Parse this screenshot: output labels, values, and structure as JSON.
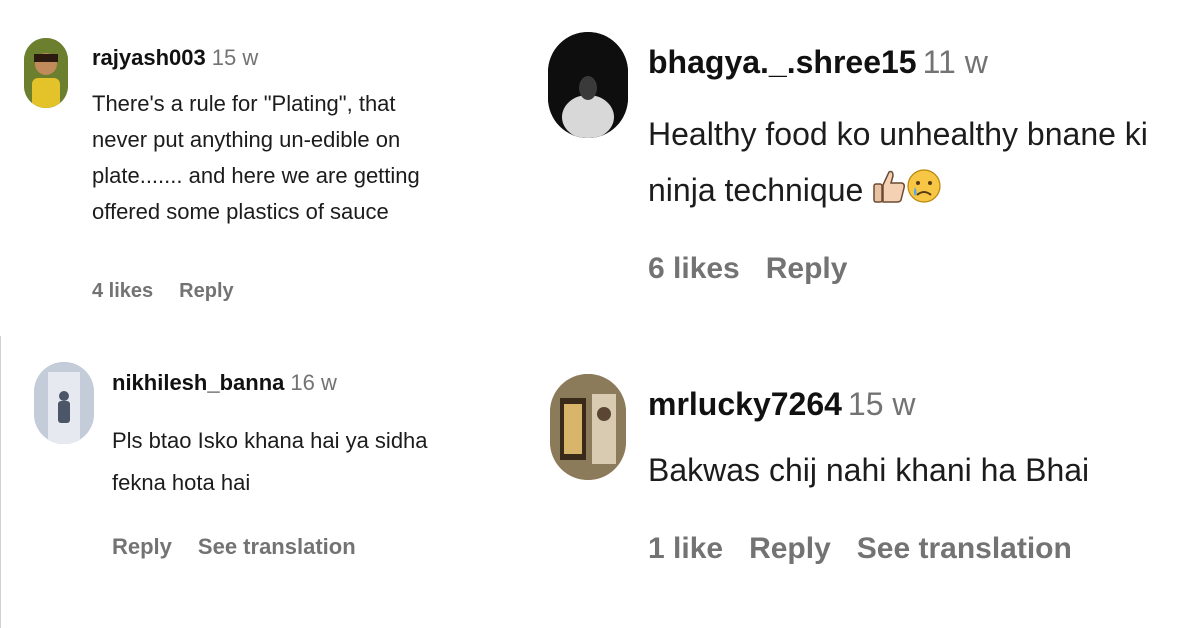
{
  "comments": [
    {
      "username": "rajyash003",
      "time": "15 w",
      "lines": [
        "There's a rule for \"Plating\", that",
        "never put anything un-edible on",
        "plate....... and here we are getting",
        "offered some plastics of sauce"
      ],
      "likes": "4 likes",
      "reply": "Reply"
    },
    {
      "username": "bhagya._.shree15",
      "time": "11 w",
      "lines": [
        "Healthy food ko unhealthy bnane ki",
        "ninja technique"
      ],
      "emojis": [
        "thumbs-up-icon",
        "crying-face-icon"
      ],
      "likes": "6 likes",
      "reply": "Reply"
    },
    {
      "username": "nikhilesh_banna",
      "time": "16 w",
      "lines": [
        "Pls btao Isko khana hai ya sidha",
        "fekna hota hai"
      ],
      "reply": "Reply",
      "translate": "See translation"
    },
    {
      "username": "mrlucky7264",
      "time": "15 w",
      "lines": [
        "Bakwas chij nahi khani ha Bhai"
      ],
      "likes": "1 like",
      "reply": "Reply",
      "translate": "See translation"
    }
  ]
}
